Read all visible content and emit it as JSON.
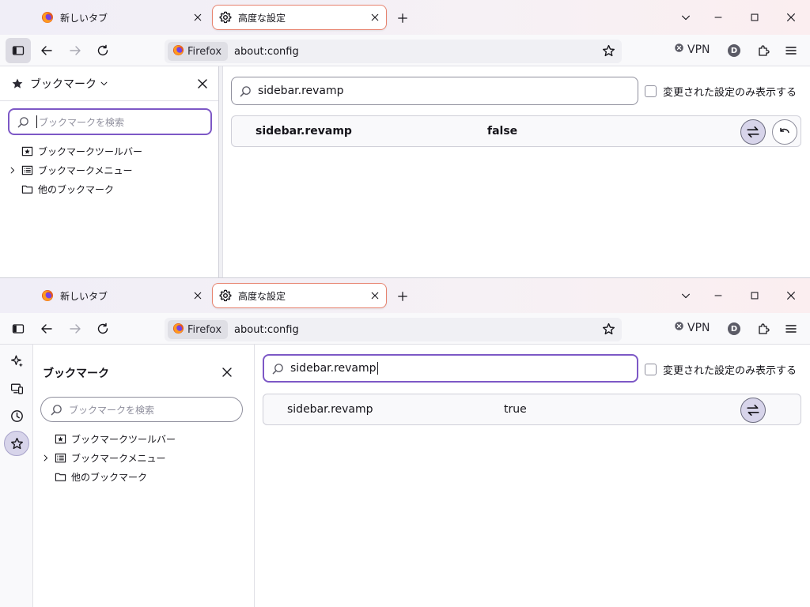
{
  "top_window": {
    "tabs": [
      {
        "label": "新しいタブ",
        "icon": "firefox-icon",
        "active": false
      },
      {
        "label": "高度な設定",
        "icon": "gear-icon",
        "active": true
      }
    ],
    "identity_label": "Firefox",
    "url": "about:config",
    "vpn_label": "VPN",
    "avatar_initial": "D",
    "sidebar": {
      "title": "ブックマーク",
      "search_placeholder": "ブックマークを検索",
      "items": [
        {
          "label": "ブックマークツールバー",
          "icon": "bookmark-toolbar-icon",
          "expandable": false
        },
        {
          "label": "ブックマークメニュー",
          "icon": "bookmark-menu-icon",
          "expandable": true
        },
        {
          "label": "他のブックマーク",
          "icon": "folder-icon",
          "expandable": false
        }
      ]
    },
    "config": {
      "search_value": "sidebar.revamp",
      "modified_only_label": "変更された設定のみ表示する",
      "pref_name": "sidebar.revamp",
      "pref_value": "false"
    }
  },
  "bottom_window": {
    "tabs": [
      {
        "label": "新しいタブ",
        "icon": "firefox-icon",
        "active": false
      },
      {
        "label": "高度な設定",
        "icon": "gear-icon",
        "active": true
      }
    ],
    "identity_label": "Firefox",
    "url": "about:config",
    "vpn_label": "VPN",
    "avatar_initial": "D",
    "launcher": [
      "ai-chatbot-icon",
      "synced-tabs-icon",
      "history-icon",
      "bookmarks-star-icon"
    ],
    "sidebar": {
      "title": "ブックマーク",
      "search_placeholder": "ブックマークを検索",
      "items": [
        {
          "label": "ブックマークツールバー",
          "icon": "bookmark-toolbar-icon",
          "expandable": false
        },
        {
          "label": "ブックマークメニュー",
          "icon": "bookmark-menu-icon",
          "expandable": true
        },
        {
          "label": "他のブックマーク",
          "icon": "folder-icon",
          "expandable": false
        }
      ]
    },
    "config": {
      "search_value": "sidebar.revamp",
      "modified_only_label": "変更された設定のみ表示する",
      "pref_name": "sidebar.revamp",
      "pref_value": "true"
    }
  },
  "colors": {
    "accent": "#7d58c6",
    "active_tab_border": "#e7836f"
  }
}
